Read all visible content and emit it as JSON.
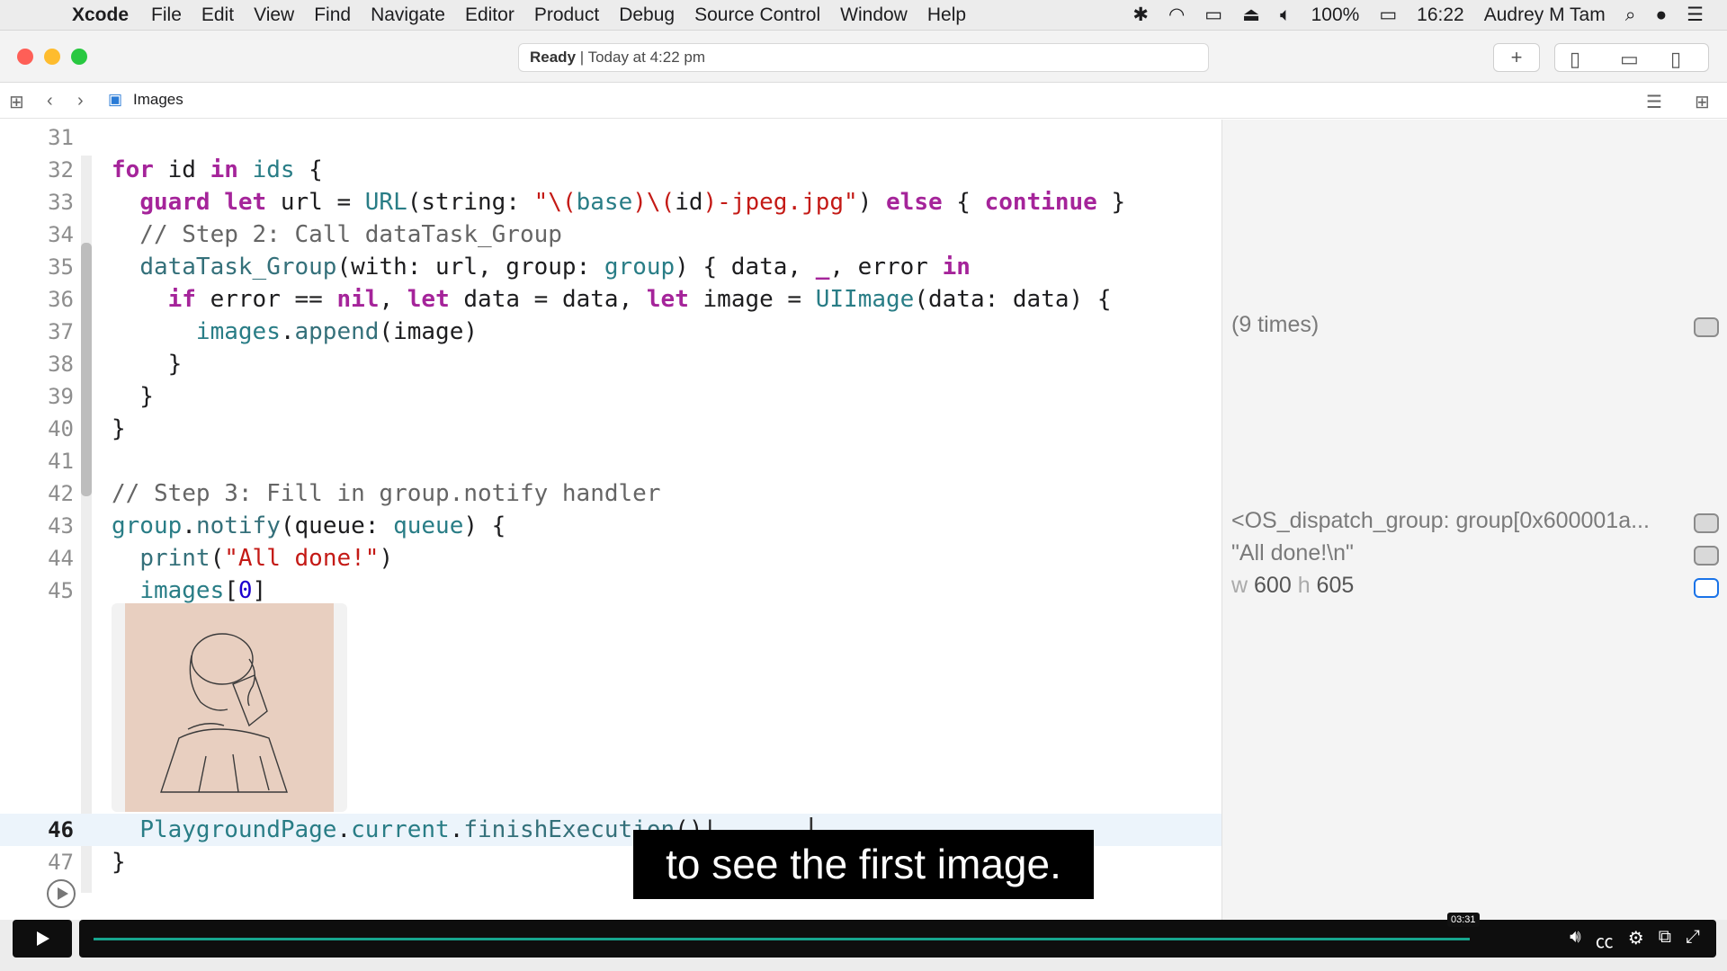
{
  "menubar": {
    "apple": "",
    "app": "Xcode",
    "items": [
      "File",
      "Edit",
      "View",
      "Find",
      "Navigate",
      "Editor",
      "Product",
      "Debug",
      "Source Control",
      "Window",
      "Help"
    ],
    "battery": "100%",
    "time": "16:22",
    "user": "Audrey M Tam"
  },
  "titlebar": {
    "status_bold": "Ready",
    "status_rest": " | Today at 4:22 pm",
    "add": "+"
  },
  "jumpbar": {
    "file": "Images"
  },
  "results": {
    "times": "(9 times)",
    "group": "<OS_dispatch_group: group[0x600001a...",
    "done": "\"All done!\\n\"",
    "w_label": "w",
    "w_value": "600",
    "h_label": "h",
    "h_value": "605"
  },
  "caption": "to see the first image.",
  "player": {
    "time": "03:31"
  },
  "colors": {
    "keyword": "#a5249a",
    "string": "#c41a16",
    "comment": "#656565",
    "type": "#297d86",
    "accent": "#17a58e"
  }
}
